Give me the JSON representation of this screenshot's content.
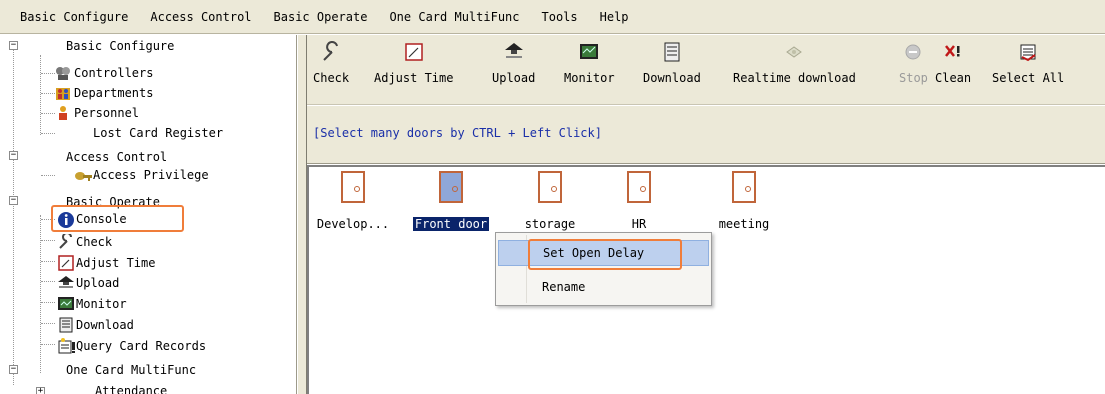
{
  "menubar": {
    "items": [
      {
        "label": "Basic Configure"
      },
      {
        "label": "Access Control"
      },
      {
        "label": "Basic Operate"
      },
      {
        "label": "One Card MultiFunc"
      },
      {
        "label": "Tools"
      },
      {
        "label": "Help"
      }
    ]
  },
  "tree": {
    "items": [
      {
        "label": "Basic Configure",
        "icon": "folder-group"
      },
      {
        "label": "Controllers",
        "icon": "controllers-icon"
      },
      {
        "label": "Departments",
        "icon": "departments-icon"
      },
      {
        "label": "Personnel",
        "icon": "personnel-icon"
      },
      {
        "label": "Lost Card Register",
        "icon": "none"
      },
      {
        "label": "Access Control",
        "icon": "folder-group"
      },
      {
        "label": "Access Privilege",
        "icon": "key-icon"
      },
      {
        "label": "Basic Operate",
        "icon": "folder-group"
      },
      {
        "label": "Console",
        "icon": "info-icon"
      },
      {
        "label": "Check",
        "icon": "wrench-icon"
      },
      {
        "label": "Adjust Time",
        "icon": "clock-icon"
      },
      {
        "label": "Upload",
        "icon": "upload-icon"
      },
      {
        "label": "Monitor",
        "icon": "monitor-icon"
      },
      {
        "label": "Download",
        "icon": "download-icon"
      },
      {
        "label": "Query Card Records",
        "icon": "records-icon"
      },
      {
        "label": "One Card MultiFunc",
        "icon": "folder-group"
      },
      {
        "label": "Attendance",
        "icon": "folder-group"
      }
    ]
  },
  "toolbar": {
    "buttons": [
      {
        "label": "Check",
        "icon": "wrench-icon",
        "enabled": true
      },
      {
        "label": "Adjust Time",
        "icon": "clock-icon",
        "enabled": true
      },
      {
        "label": "Upload",
        "icon": "upload-icon",
        "enabled": true
      },
      {
        "label": "Monitor",
        "icon": "monitor-icon",
        "enabled": true
      },
      {
        "label": "Download",
        "icon": "download-icon",
        "enabled": true
      },
      {
        "label": "Realtime download",
        "icon": "realtime-download-icon",
        "enabled": true
      },
      {
        "label": "Stop",
        "icon": "stop-icon",
        "enabled": false
      },
      {
        "label": "Clean",
        "icon": "clean-icon",
        "enabled": true
      },
      {
        "label": "Select All",
        "icon": "select-all-icon",
        "enabled": true
      }
    ]
  },
  "hint": "[Select many doors by CTRL + Left Click]",
  "doors": [
    {
      "label": "Develop...",
      "selected": false
    },
    {
      "label": "Front door",
      "selected": true
    },
    {
      "label": "storage",
      "selected": false
    },
    {
      "label": "HR",
      "selected": false
    },
    {
      "label": "meeting",
      "selected": false
    }
  ],
  "context_menu": {
    "items": [
      {
        "label": "Set Open Delay",
        "highlighted": true
      },
      {
        "label": "Rename",
        "highlighted": false
      }
    ]
  },
  "colors": {
    "annotation": "#f07d3a",
    "selection": "#0a246a",
    "hint_text": "#1a2fa8",
    "chrome": "#ece9d8"
  }
}
